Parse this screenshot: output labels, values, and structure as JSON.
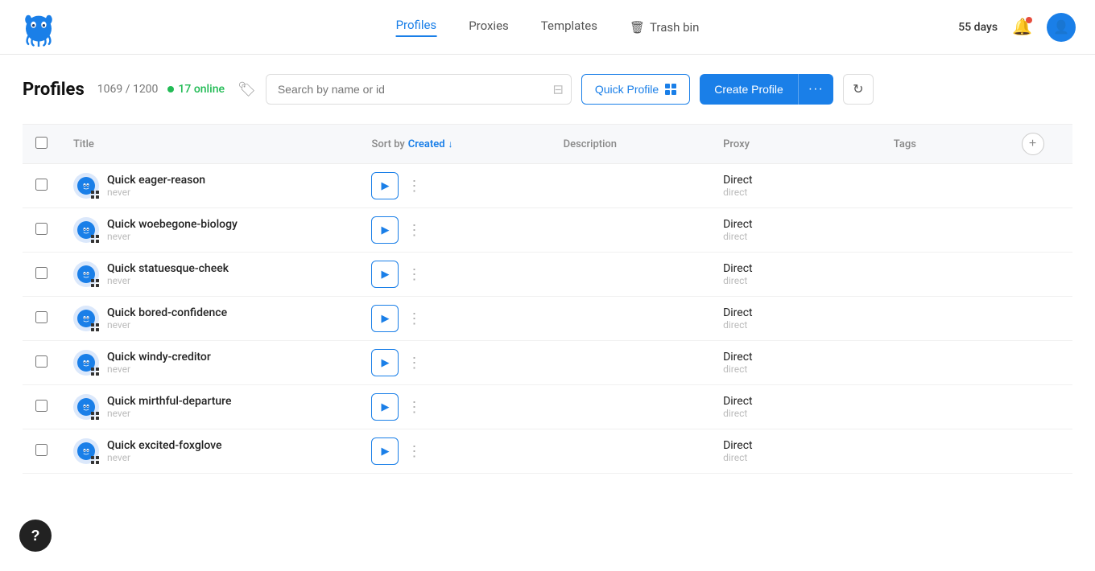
{
  "app": {
    "logo_alt": "Octo Browser Logo"
  },
  "navbar": {
    "days_label": "55 days",
    "links": [
      {
        "id": "profiles",
        "label": "Profiles",
        "active": true
      },
      {
        "id": "proxies",
        "label": "Proxies",
        "active": false
      },
      {
        "id": "templates",
        "label": "Templates",
        "active": false
      },
      {
        "id": "trash",
        "label": "Trash bin",
        "active": false
      }
    ]
  },
  "header": {
    "title": "Profiles",
    "count": "1069 / 1200",
    "online_count": "17 online",
    "search_placeholder": "Search by name or id",
    "quick_profile_label": "Quick Profile",
    "create_profile_label": "Create Profile",
    "create_profile_dots": "···"
  },
  "table": {
    "columns": {
      "title": "Title",
      "sort_by": "Sort by",
      "sort_value": "Created",
      "description": "Description",
      "proxy": "Proxy",
      "tags": "Tags"
    },
    "rows": [
      {
        "id": 1,
        "name": "Quick eager-reason",
        "time": "never",
        "description": "",
        "proxy_main": "Direct",
        "proxy_sub": "direct",
        "tags": ""
      },
      {
        "id": 2,
        "name": "Quick woebegone-biology",
        "time": "never",
        "description": "",
        "proxy_main": "Direct",
        "proxy_sub": "direct",
        "tags": ""
      },
      {
        "id": 3,
        "name": "Quick statuesque-cheek",
        "time": "never",
        "description": "",
        "proxy_main": "Direct",
        "proxy_sub": "direct",
        "tags": ""
      },
      {
        "id": 4,
        "name": "Quick bored-confidence",
        "time": "never",
        "description": "",
        "proxy_main": "Direct",
        "proxy_sub": "direct",
        "tags": ""
      },
      {
        "id": 5,
        "name": "Quick windy-creditor",
        "time": "never",
        "description": "",
        "proxy_main": "Direct",
        "proxy_sub": "direct",
        "tags": ""
      },
      {
        "id": 6,
        "name": "Quick mirthful-departure",
        "time": "never",
        "description": "",
        "proxy_main": "Direct",
        "proxy_sub": "direct",
        "tags": ""
      },
      {
        "id": 7,
        "name": "Quick excited-foxglove",
        "time": "never",
        "description": "",
        "proxy_main": "Direct",
        "proxy_sub": "direct",
        "tags": ""
      }
    ]
  },
  "help_btn_label": "?"
}
